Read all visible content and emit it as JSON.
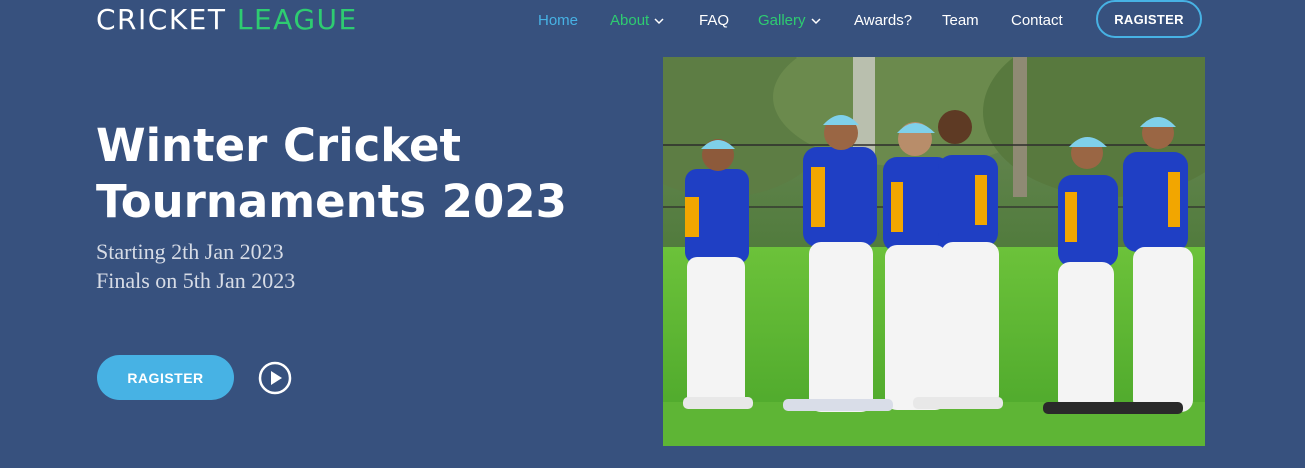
{
  "logo": {
    "part1": "CRICKET",
    "part2": "LEAGUE"
  },
  "nav": {
    "home": "Home",
    "about": "About",
    "faq": "FAQ",
    "gallery": "Gallery",
    "awards": "Awards?",
    "team": "Team",
    "contact": "Contact",
    "register": "RAGISTER"
  },
  "hero": {
    "title_line1": "Winter Cricket",
    "title_line2": "Tournaments 2023",
    "sub_line1": "Starting 2th Jan 2023",
    "sub_line2": "Finals on 5th Jan 2023",
    "register": "RAGISTER",
    "image_alt": "youth cricket team celebrating"
  },
  "colors": {
    "background": "#37517e",
    "accent_blue": "#47b2e4",
    "accent_green": "#2ecc71"
  },
  "icons": {
    "dropdown": "chevron-down-icon",
    "play": "play-circle-icon"
  }
}
